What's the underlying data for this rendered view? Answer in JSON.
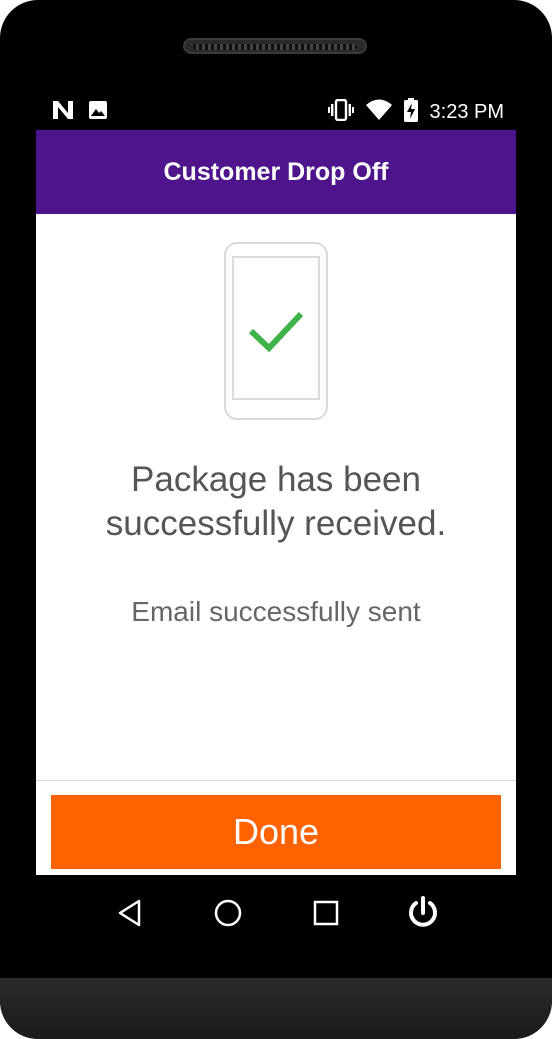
{
  "status_bar": {
    "time": "3:23 PM",
    "icons_left": [
      "n-notification-icon",
      "image-notification-icon"
    ],
    "icons_right": [
      "vibrate-icon",
      "wifi-icon",
      "battery-charging-icon"
    ]
  },
  "app_bar": {
    "title": "Customer Drop Off"
  },
  "content": {
    "illustration": "phone-check-icon",
    "message_line1": "Package has been",
    "message_line2": "successfully received.",
    "sub_message": "Email successfully sent"
  },
  "footer": {
    "done_label": "Done"
  },
  "nav_bar": {
    "buttons": [
      "back-icon",
      "home-icon",
      "recents-icon",
      "power-icon"
    ]
  },
  "colors": {
    "app_bar": "#4d148c",
    "done_button": "#ff6200",
    "check": "#3fb34a"
  }
}
